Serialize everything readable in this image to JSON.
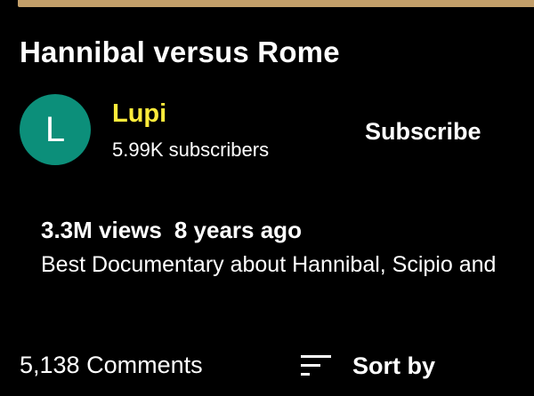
{
  "video": {
    "title": "Hannibal versus Rome",
    "views": "3.3M views",
    "age": "8 years ago",
    "description": "Best Documentary about Hannibal, Scipio and"
  },
  "channel": {
    "avatar_letter": "L",
    "avatar_color": "#0c8f7a",
    "name": "Lupi",
    "name_color": "#ffeb3b",
    "subscribers": "5.99K subscribers",
    "subscribe_label": "Subscribe"
  },
  "comments": {
    "count_label": "5,138 Comments",
    "sort_label": "Sort by",
    "sort_icon": "sort-lines-icon"
  },
  "colors": {
    "background": "#000000",
    "player_bar": "#c39f6a",
    "text": "#ffffff"
  }
}
